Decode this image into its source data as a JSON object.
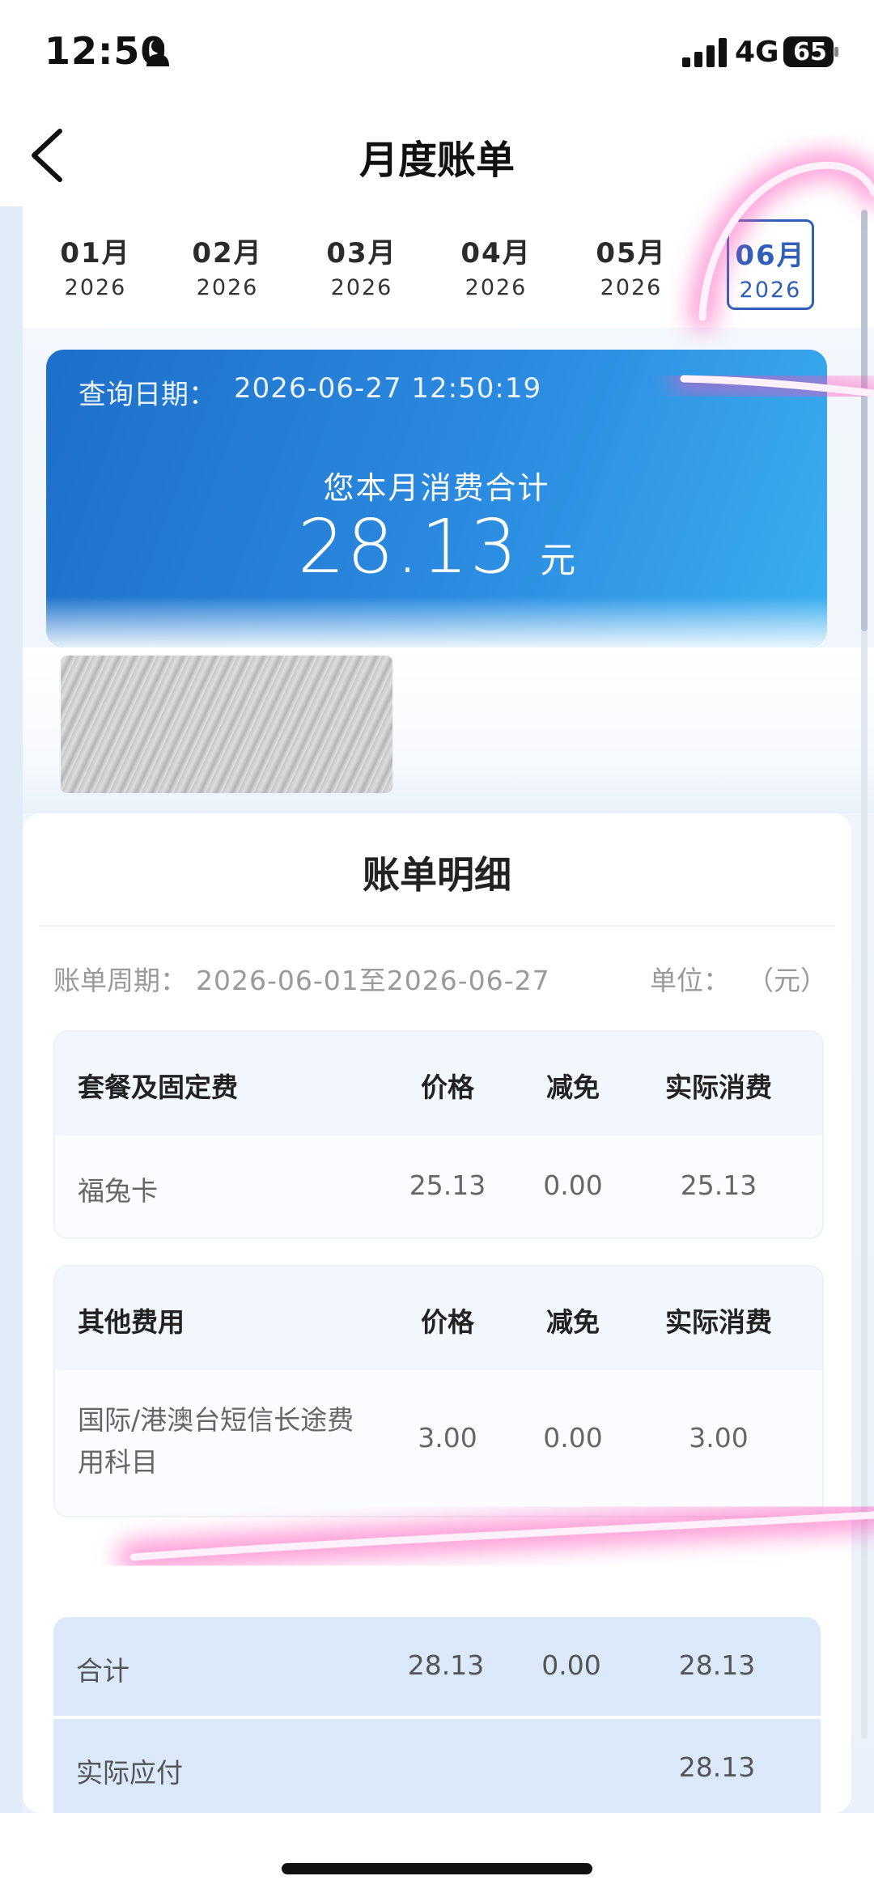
{
  "status_bar": {
    "time": "12:50",
    "network": "4G",
    "battery": "65",
    "icons": [
      "person-icon",
      "signal-icon",
      "battery-icon"
    ]
  },
  "nav": {
    "title": "月度账单",
    "back_icon": "chevron-left-icon"
  },
  "months": [
    {
      "month": "01月",
      "year": "2026",
      "active": false
    },
    {
      "month": "02月",
      "year": "2026",
      "active": false
    },
    {
      "month": "03月",
      "year": "2026",
      "active": false
    },
    {
      "month": "04月",
      "year": "2026",
      "active": false
    },
    {
      "month": "05月",
      "year": "2026",
      "active": false
    },
    {
      "month": "06月",
      "year": "2026",
      "active": true
    }
  ],
  "summary": {
    "query_label": "查询日期：",
    "query_date": "2026-06-27 12:50:19",
    "caption": "您本月消费合计",
    "amount": "28.13",
    "unit": "元"
  },
  "detail": {
    "title": "账单明细",
    "period_label": "账单周期：",
    "period_value": "2026-06-01至2026-06-27",
    "unit_label": "单位：",
    "unit_value": "（元）",
    "tables": [
      {
        "header": [
          "套餐及固定费",
          "价格",
          "减免",
          "实际消费"
        ],
        "rows": [
          [
            "福兔卡",
            "25.13",
            "0.00",
            "25.13"
          ]
        ]
      },
      {
        "header": [
          "其他费用",
          "价格",
          "减免",
          "实际消费"
        ],
        "rows": [
          [
            "国际/港澳台短信长途费用科目",
            "3.00",
            "0.00",
            "3.00"
          ]
        ]
      }
    ],
    "total": {
      "label": "合计",
      "price": "28.13",
      "discount": "0.00",
      "actual": "28.13"
    },
    "payable": {
      "label": "实际应付",
      "actual": "28.13"
    }
  },
  "colors": {
    "accent": "#2f5fb8",
    "card_gradient_start": "#1e6fc9",
    "card_gradient_end": "#3aaef0",
    "table_header_bg": "#f2f7fe",
    "total_row_bg": "#dbe9fb",
    "scribble": "#ff4fb8"
  }
}
